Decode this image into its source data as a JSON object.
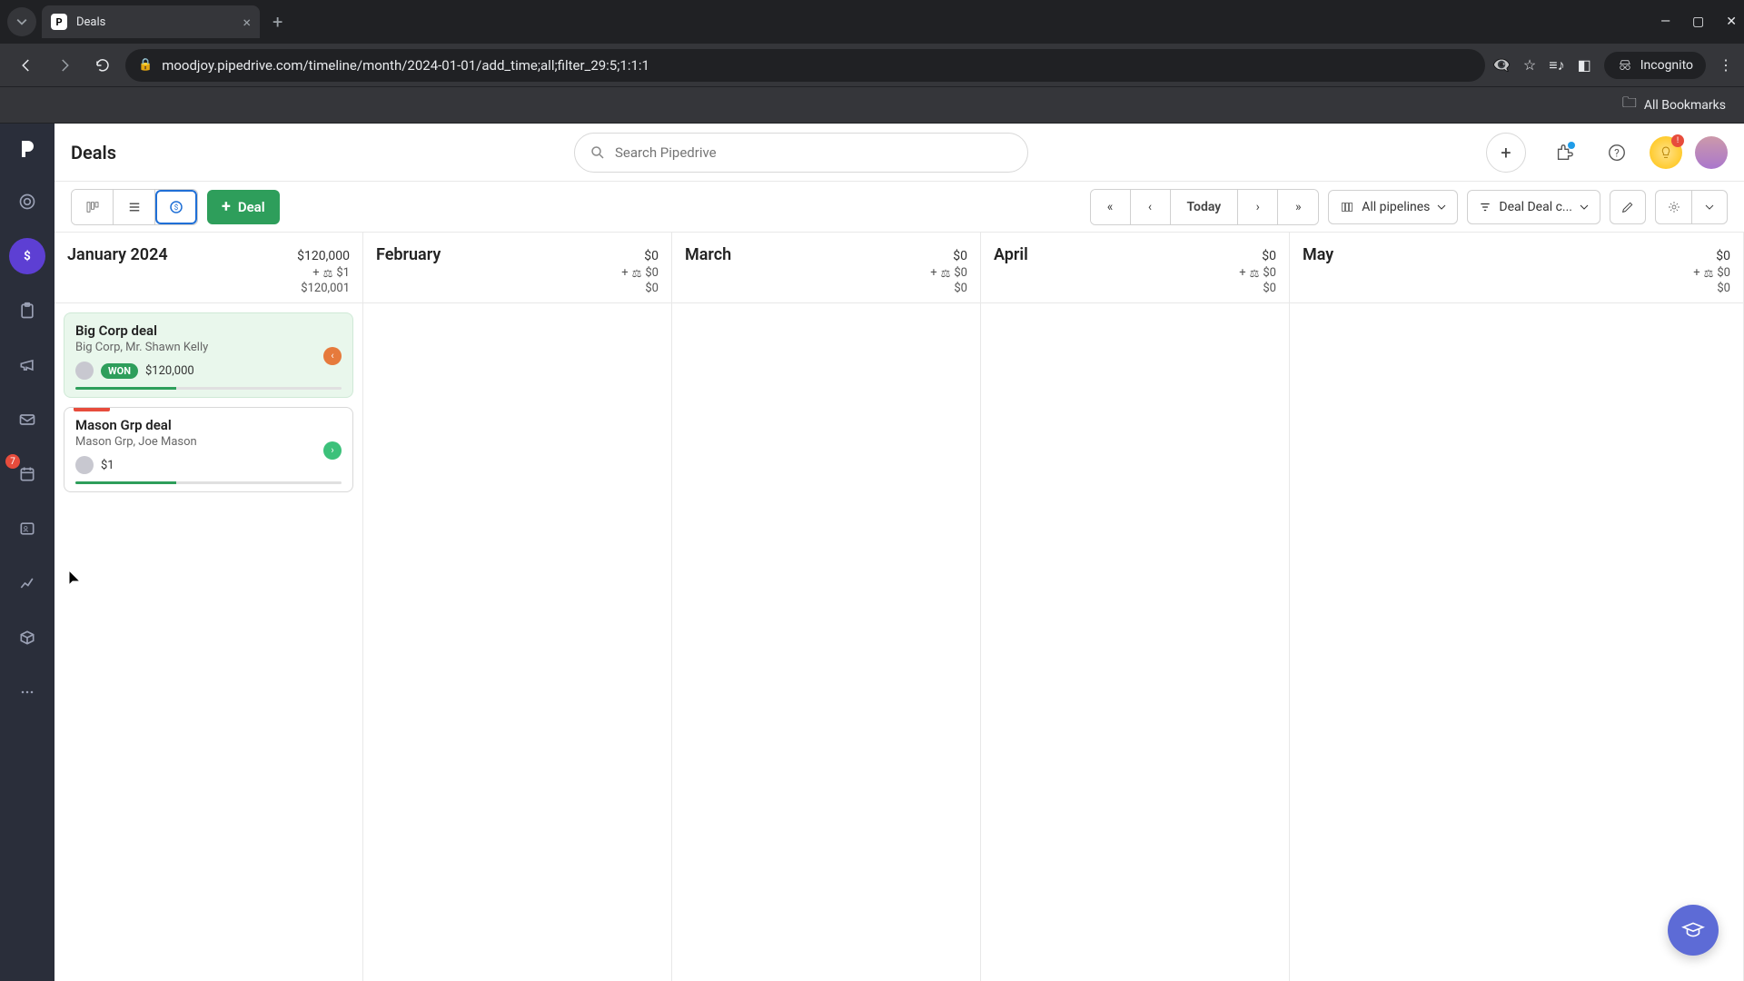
{
  "browser": {
    "tab_title": "Deals",
    "url": "moodjoy.pipedrive.com/timeline/month/2024-01-01/add_time;all;filter_29:5;1:1:1",
    "incognito_label": "Incognito",
    "bookmarks_label": "All Bookmarks"
  },
  "sidebar": {
    "badge": "7"
  },
  "header": {
    "title": "Deals",
    "search_placeholder": "Search Pipedrive",
    "hint_badge": "!"
  },
  "toolbar": {
    "deal_label": "Deal",
    "today_label": "Today",
    "pipeline_label": "All pipelines",
    "filter_label": "Deal Deal c..."
  },
  "months": [
    {
      "name": "January 2024",
      "total": "$120,000",
      "weighted": "$1",
      "sum": "$120,001"
    },
    {
      "name": "February",
      "total": "$0",
      "weighted": "$0",
      "sum": "$0"
    },
    {
      "name": "March",
      "total": "$0",
      "weighted": "$0",
      "sum": "$0"
    },
    {
      "name": "April",
      "total": "$0",
      "weighted": "$0",
      "sum": "$0"
    },
    {
      "name": "May",
      "total": "$0",
      "weighted": "$0",
      "sum": "$0"
    }
  ],
  "deals": [
    {
      "title": "Big Corp deal",
      "subtitle": "Big Corp, Mr. Shawn Kelly",
      "badge": "WON",
      "amount": "$120,000",
      "status": "red",
      "won": true
    },
    {
      "title": "Mason Grp deal",
      "subtitle": "Mason Grp, Joe Mason",
      "badge": "",
      "amount": "$1",
      "status": "green",
      "won": false
    }
  ],
  "plus_sign": "+"
}
